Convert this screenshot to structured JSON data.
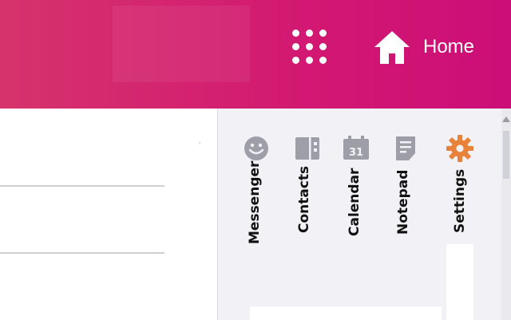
{
  "header": {
    "home_label": "Home"
  },
  "apps": [
    {
      "label": "Messenger",
      "icon": "smiley-face-icon",
      "color": "#9e9ea8"
    },
    {
      "label": "Contacts",
      "icon": "contacts-book-icon",
      "color": "#9e9ea8"
    },
    {
      "label": "Calendar",
      "icon": "calendar-icon",
      "color": "#9e9ea8",
      "icon_text": "31"
    },
    {
      "label": "Notepad",
      "icon": "notepad-icon",
      "color": "#9e9ea8"
    },
    {
      "label": "Settings",
      "icon": "gear-icon",
      "color": "#e8823a"
    }
  ],
  "colors": {
    "header_start": "#d6336c",
    "header_end": "#cc0e78",
    "panel_bg": "#f2f2f6",
    "icon_gray": "#9e9ea8",
    "settings_orange": "#e8823a"
  }
}
